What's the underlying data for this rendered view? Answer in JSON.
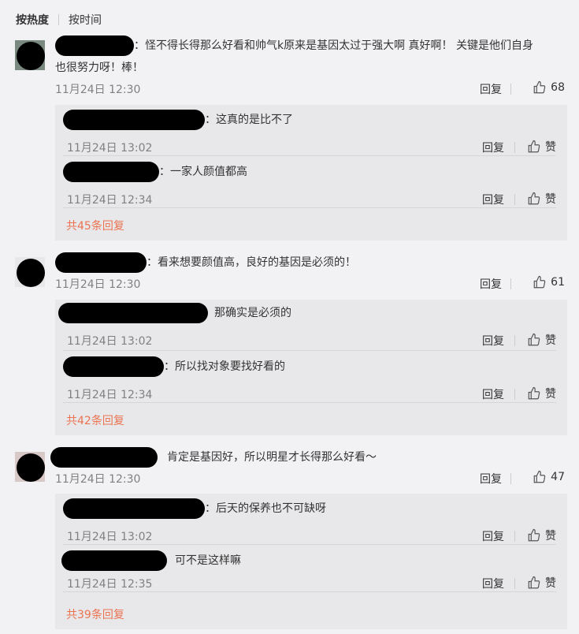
{
  "sort": {
    "hot": "按热度",
    "time": "按时间"
  },
  "labels": {
    "reply": "回复",
    "like": "赞"
  },
  "colors": {
    "more_link": "#eb7350",
    "reply_bg": "#e8e8eb",
    "page_bg": "#f2f2f5"
  },
  "comments": [
    {
      "text": "：怪不得长得那么好看和帅气k原来是基因太过于强大啊 真好啊！ 关键是他们自身",
      "text2": "也很努力呀！棒！",
      "time": "11月24日 12:30",
      "likes": "68",
      "replies": [
        {
          "text": "：这真的是比不了",
          "time": "11月24日 13:02"
        },
        {
          "text": "：一家人颜值都高",
          "time": "11月24日 12:34"
        }
      ],
      "more": "共45条回复"
    },
    {
      "text": "：看来想要颜值高，良好的基因是必须的！",
      "time": "11月24日 12:30",
      "likes": "61",
      "replies": [
        {
          "text": "那确实是必须的",
          "time": "11月24日 13:02"
        },
        {
          "text": "：所以找对象要找好看的",
          "time": "11月24日 12:34"
        }
      ],
      "more": "共42条回复"
    },
    {
      "text": "肯定是基因好，所以明星才长得那么好看～",
      "time": "11月24日 12:30",
      "likes": "47",
      "replies": [
        {
          "text": "：后天的保养也不可缺呀",
          "time": "11月24日 13:02"
        },
        {
          "text": "可不是这样嘛",
          "time": "11月24日 12:35"
        }
      ],
      "more": "共39条回复"
    }
  ]
}
